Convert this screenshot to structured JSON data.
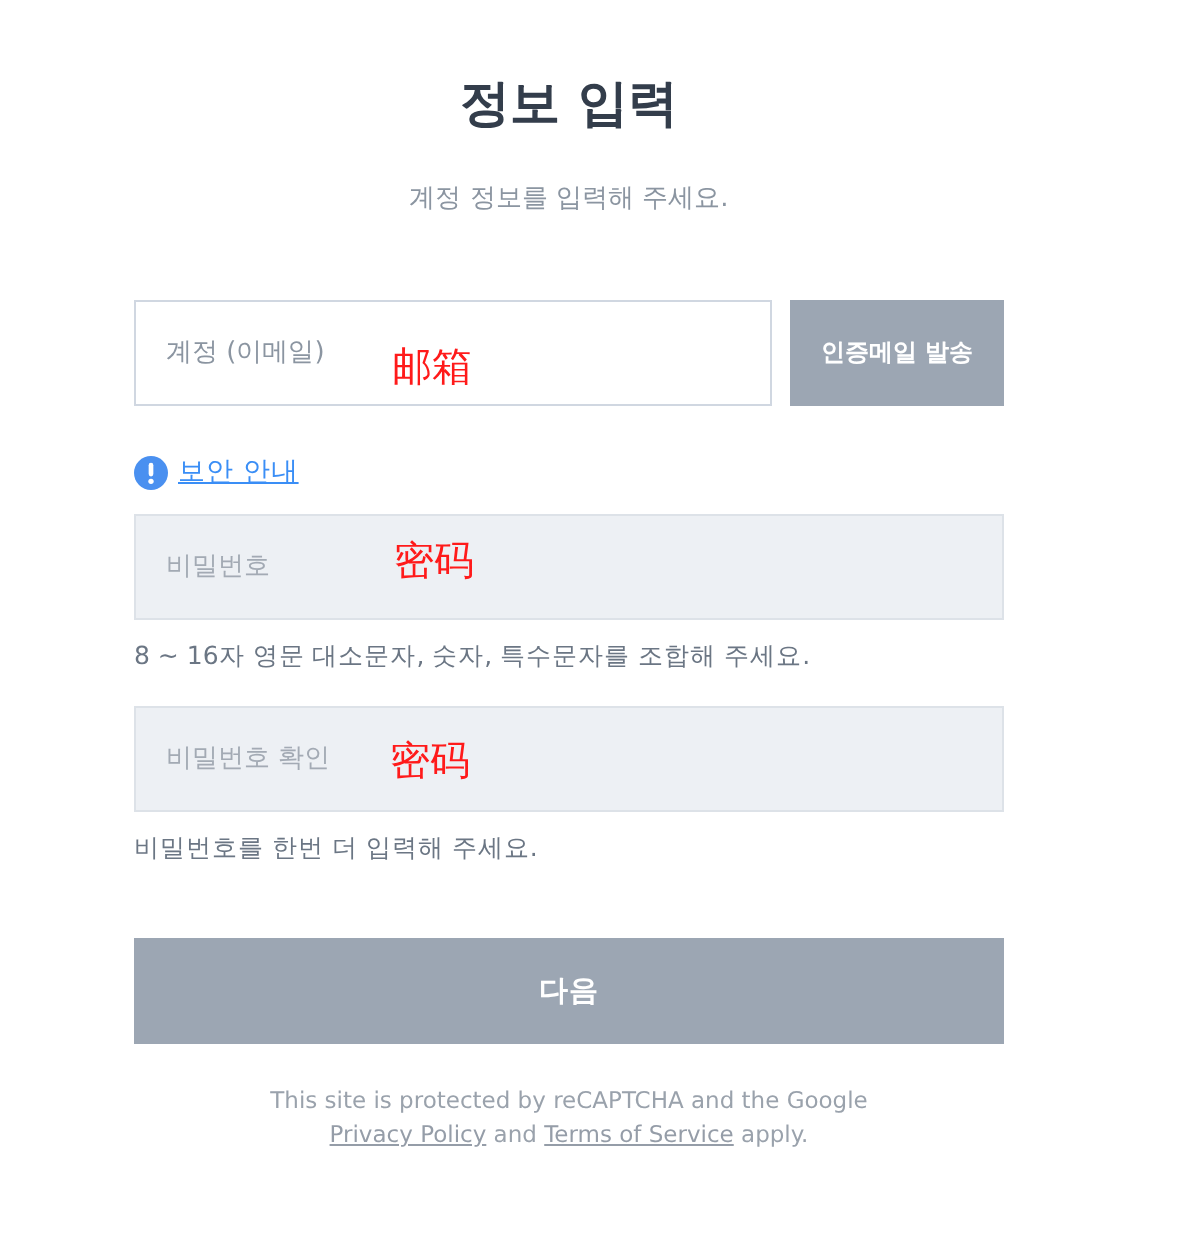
{
  "header": {
    "title": "정보 입력",
    "subtitle": "계정 정보를 입력해 주세요."
  },
  "email": {
    "field": {
      "placeholder": "계정 (이메일)",
      "disabled": false,
      "annotation": "邮箱"
    },
    "send_button": {
      "label": "인증메일 발송",
      "disabled": true
    }
  },
  "security_link": {
    "label": "보안 안내"
  },
  "password_fields": [
    {
      "placeholder": "비밀번호",
      "disabled": true,
      "annotation": "密码",
      "hint": "8 ~ 16자 영문 대소문자, 숫자, 특수문자를 조합해 주세요."
    },
    {
      "placeholder": "비밀번호 확인",
      "disabled": true,
      "annotation": "密码",
      "hint": "비밀번호를 한번 더 입력해 주세요."
    }
  ],
  "next_button": {
    "label": "다음",
    "disabled": true
  },
  "footer": {
    "lines": [
      {
        "parts": [
          {
            "kind": "text",
            "text": "This site is protected by reCAPTCHA and the Google"
          }
        ]
      },
      {
        "parts": [
          {
            "kind": "link",
            "text": "Privacy Policy"
          },
          {
            "kind": "text",
            "text": " and "
          },
          {
            "kind": "link",
            "text": "Terms of Service"
          },
          {
            "kind": "text",
            "text": " apply."
          }
        ]
      }
    ]
  }
}
